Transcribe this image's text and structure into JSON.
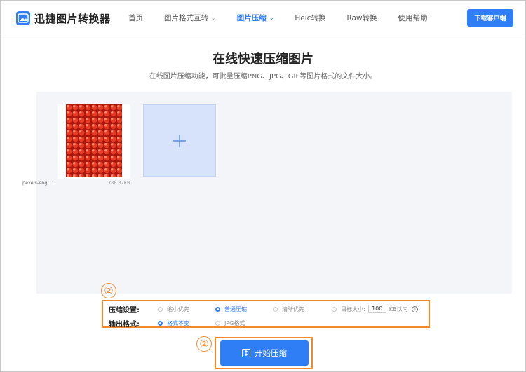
{
  "app": {
    "logo_text": "迅捷图片转换器",
    "download_label": "下载客户端"
  },
  "nav": [
    {
      "label": "首页",
      "dropdown": false,
      "active": false
    },
    {
      "label": "图片格式互转",
      "dropdown": true,
      "active": false
    },
    {
      "label": "图片压缩",
      "dropdown": true,
      "active": true
    },
    {
      "label": "Heic转换",
      "dropdown": false,
      "active": false
    },
    {
      "label": "Raw转换",
      "dropdown": false,
      "active": false
    },
    {
      "label": "使用帮助",
      "dropdown": false,
      "active": false
    }
  ],
  "page": {
    "title": "在线快速压缩图片",
    "subtitle": "在线图片压缩功能，可批量压缩PNG、JPG、GIF等图片格式的文件大小。"
  },
  "file": {
    "name": "pexels-engi...",
    "size": "786.37KB"
  },
  "compress_settings": {
    "label": "压缩设置:",
    "options": [
      "缩小优先",
      "普通压缩",
      "清晰优先"
    ],
    "selected": "普通压缩",
    "target_label": "目标大小:",
    "target_value": "100",
    "target_unit": "KB以内"
  },
  "output_format": {
    "label": "输出格式:",
    "options": [
      "格式不变",
      "JPG格式"
    ],
    "selected": "格式不变"
  },
  "markers": {
    "settings": "②",
    "start": "②"
  },
  "start_button": {
    "label": "开始压缩"
  },
  "colors": {
    "accent": "#2f7ef5",
    "highlight": "#f28a2c"
  }
}
